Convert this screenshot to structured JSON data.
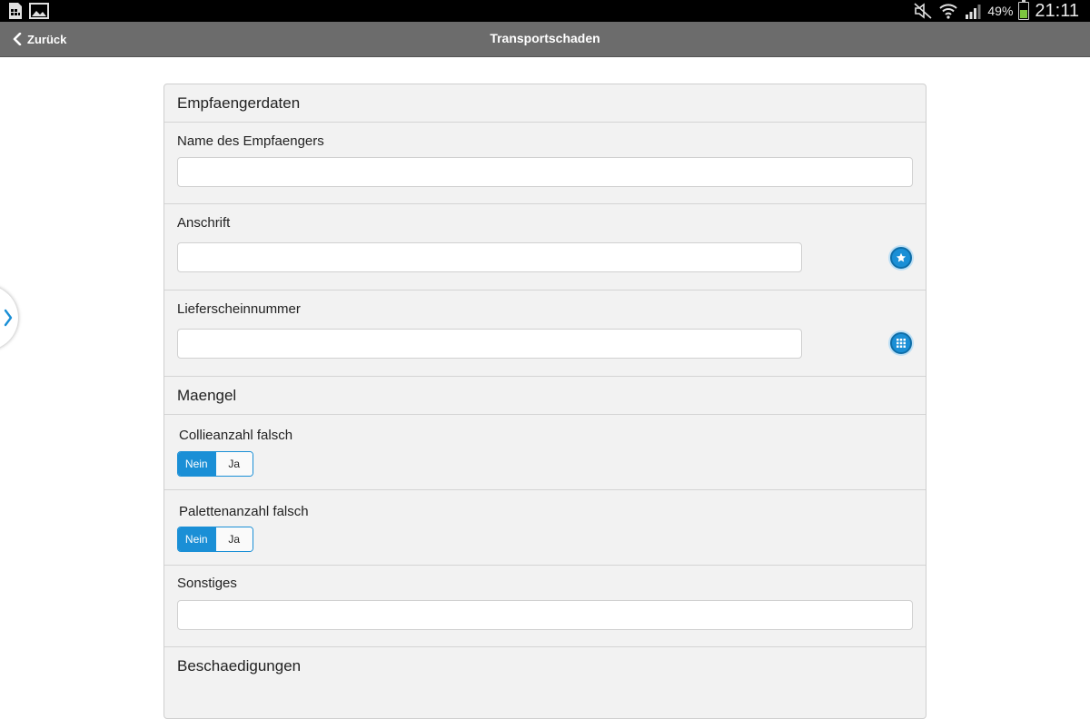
{
  "status_bar": {
    "battery_percent": "49%",
    "battery_level": 0.49,
    "time": "21:11",
    "icons": [
      "sim-card-icon",
      "gallery-icon",
      "mute-icon",
      "wifi-icon",
      "signal-icon",
      "battery-icon"
    ]
  },
  "header": {
    "back_label": "Zurück",
    "title": "Transportschaden"
  },
  "form": {
    "sections": {
      "recipient": "Empfaengerdaten",
      "defects": "Maengel",
      "damages": "Beschaedigungen"
    },
    "fields": {
      "name": {
        "label": "Name des Empfaengers",
        "value": ""
      },
      "address": {
        "label": "Anschrift",
        "value": "",
        "action_icon": "star-icon"
      },
      "delivery_note": {
        "label": "Lieferscheinnummer",
        "value": "",
        "action_icon": "grid-icon"
      },
      "parcel_count": {
        "label": "Collieanzahl falsch",
        "options": [
          "Nein",
          "Ja"
        ],
        "selected": "Nein"
      },
      "pallet_count": {
        "label": "Palettenanzahl falsch",
        "options": [
          "Nein",
          "Ja"
        ],
        "selected": "Nein"
      },
      "other": {
        "label": "Sonstiges",
        "value": ""
      }
    }
  },
  "colors": {
    "accent": "#1a8fd6",
    "header_bg": "#6c6c6c",
    "card_bg": "#f2f2f2"
  }
}
